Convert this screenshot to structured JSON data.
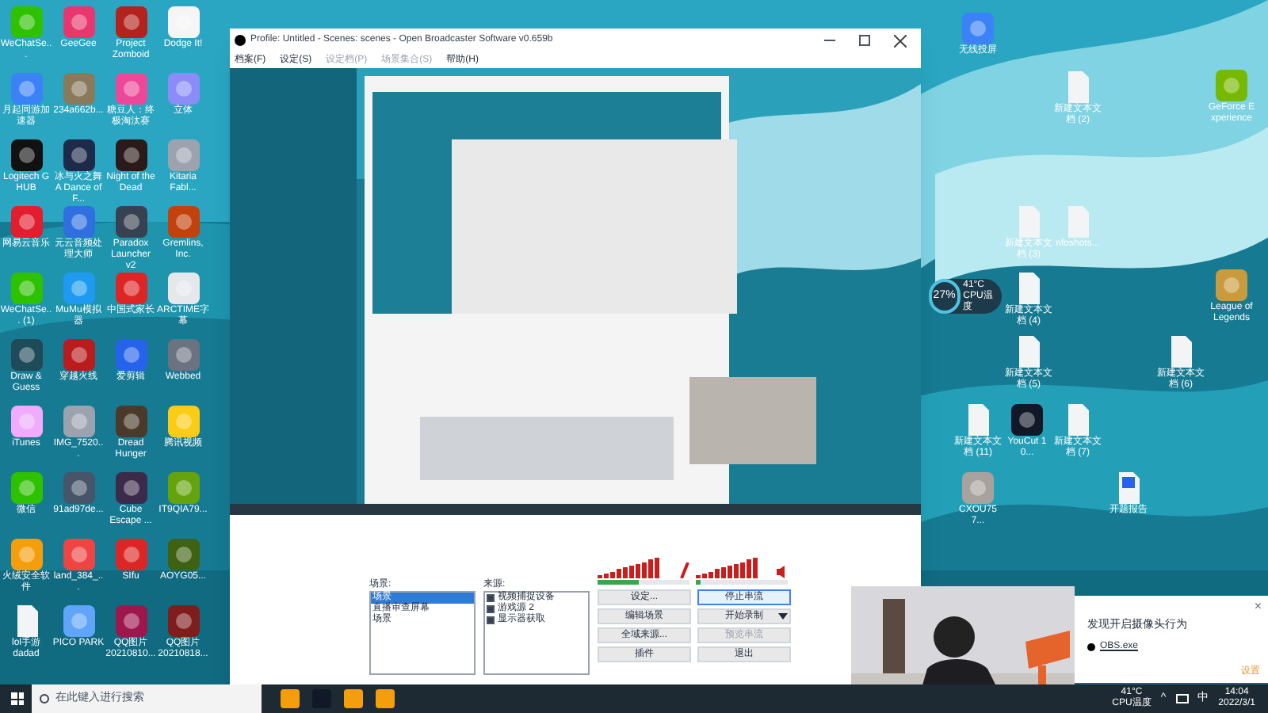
{
  "desktop": {
    "left_icons": [
      {
        "label": "WeChatSe...",
        "kind": "app",
        "color": "#2dc100"
      },
      {
        "label": "GeeGee",
        "kind": "app",
        "color": "#e8366e"
      },
      {
        "label": "Project Zomboid",
        "kind": "app",
        "color": "#b3221c"
      },
      {
        "label": "Dodge It!",
        "kind": "app",
        "color": "#f5f5f5"
      },
      {
        "label": "月起同游加速器",
        "kind": "app",
        "color": "#3b82f6"
      },
      {
        "label": "234a662b...",
        "kind": "app",
        "color": "#8a7a5c"
      },
      {
        "label": "糖豆人：终极淘汰赛",
        "kind": "app",
        "color": "#ec4899"
      },
      {
        "label": "立体",
        "kind": "app",
        "color": "#8b8cf7"
      },
      {
        "label": "Logitech G HUB",
        "kind": "app",
        "color": "#111111"
      },
      {
        "label": "冰与火之舞 A Dance of F...",
        "kind": "app",
        "color": "#1e2a4a"
      },
      {
        "label": "Night of the Dead",
        "kind": "app",
        "color": "#2a1a1a"
      },
      {
        "label": "Kitaria Fabl...",
        "kind": "app",
        "color": "#9ca3af"
      },
      {
        "label": "网易云音乐",
        "kind": "app",
        "color": "#e11d2e"
      },
      {
        "label": "元云音频处理大师",
        "kind": "app",
        "color": "#2f6fe0"
      },
      {
        "label": "Paradox Launcher v2",
        "kind": "app",
        "color": "#374151"
      },
      {
        "label": "Gremlins, Inc.",
        "kind": "app",
        "color": "#c2410c"
      },
      {
        "label": "WeChatSe... (1)",
        "kind": "app",
        "color": "#2dc100"
      },
      {
        "label": "MuMu模拟器",
        "kind": "app",
        "color": "#1e9bf0"
      },
      {
        "label": "中国式家长",
        "kind": "app",
        "color": "#dc2626"
      },
      {
        "label": "ARCTIME字幕",
        "kind": "app",
        "color": "#e5e7eb"
      },
      {
        "label": "Draw & Guess",
        "kind": "app",
        "color": "#1f4a5a"
      },
      {
        "label": "穿越火线",
        "kind": "app",
        "color": "#b91c1c"
      },
      {
        "label": "爱剪辑",
        "kind": "app",
        "color": "#2563eb"
      },
      {
        "label": "Webbed",
        "kind": "app",
        "color": "#6b7280"
      },
      {
        "label": "iTunes",
        "kind": "app",
        "color": "#f0abfc"
      },
      {
        "label": "IMG_7520...",
        "kind": "app",
        "color": "#9ca3af"
      },
      {
        "label": "Dread Hunger",
        "kind": "app",
        "color": "#4b3a2a"
      },
      {
        "label": "腾讯视频",
        "kind": "app",
        "color": "#facc15"
      },
      {
        "label": "微信",
        "kind": "app",
        "color": "#2dc100"
      },
      {
        "label": "91ad97de...",
        "kind": "app",
        "color": "#475569"
      },
      {
        "label": "Cube Escape ...",
        "kind": "app",
        "color": "#3b2a4a"
      },
      {
        "label": "IT9QIA79...",
        "kind": "app",
        "color": "#65a30d"
      },
      {
        "label": "火绒安全软件",
        "kind": "app",
        "color": "#f59e0b"
      },
      {
        "label": "land_384_...",
        "kind": "app",
        "color": "#ef4444"
      },
      {
        "label": "SIfu",
        "kind": "app",
        "color": "#dc2626"
      },
      {
        "label": "AOYG05...",
        "kind": "app",
        "color": "#3f6212"
      },
      {
        "label": "lol手游 dadad",
        "kind": "file",
        "color": "#f3f4f6"
      },
      {
        "label": "PICO PARK",
        "kind": "app",
        "color": "#60a5fa"
      },
      {
        "label": "QQ图片 20210810...",
        "kind": "app",
        "color": "#9d174d"
      },
      {
        "label": "QQ图片 20210818...",
        "kind": "app",
        "color": "#7f1d1d"
      }
    ],
    "right_icons": [
      {
        "label": "无线投屏",
        "kind": "app",
        "color": "#3b82f6"
      },
      {
        "label": "新建文本文档 (2)",
        "kind": "file",
        "color": "#f3f4f6"
      },
      {
        "label": "GeForce Experience",
        "kind": "app",
        "color": "#76b900"
      },
      {
        "label": "新建文本文档 (3)",
        "kind": "file",
        "color": "#f3f4f6"
      },
      {
        "label": "nfoshots...",
        "kind": "file",
        "color": "#f3f4f6"
      },
      {
        "label": "新建文本文档 (4)",
        "kind": "file",
        "color": "#f3f4f6"
      },
      {
        "label": "League of Legends",
        "kind": "app",
        "color": "#c89b3c"
      },
      {
        "label": "新建文本文档 (5)",
        "kind": "file",
        "color": "#f3f4f6"
      },
      {
        "label": "新建文本文档 (6)",
        "kind": "file",
        "color": "#f3f4f6"
      },
      {
        "label": "新建文本文档 (11)",
        "kind": "file",
        "color": "#f3f4f6"
      },
      {
        "label": "YouCut 10...",
        "kind": "app",
        "color": "#111827"
      },
      {
        "label": "新建文本文档 (7)",
        "kind": "file",
        "color": "#f3f4f6"
      },
      {
        "label": "CXOU757...",
        "kind": "app",
        "color": "#a8a29e"
      },
      {
        "label": "开题报告",
        "kind": "doc",
        "color": "#2563eb"
      }
    ]
  },
  "cpu_widget": {
    "percent": "27%",
    "temp": "41°C",
    "label": "CPU温度"
  },
  "obs": {
    "title": "Profile: Untitled - Scenes: scenes - Open Broadcaster Software v0.659b",
    "menu": [
      {
        "label": "档案(F)",
        "disabled": false
      },
      {
        "label": "设定(S)",
        "disabled": false
      },
      {
        "label": "设定档(P)",
        "disabled": true
      },
      {
        "label": "场景集合(S)",
        "disabled": true
      },
      {
        "label": "帮助(H)",
        "disabled": false
      }
    ],
    "scenes_label": "场景:",
    "scenes": [
      {
        "label": "场景",
        "selected": true
      },
      {
        "label": "直播审查屏幕",
        "selected": false
      },
      {
        "label": "场景",
        "selected": false
      }
    ],
    "sources_label": "来源:",
    "sources": [
      {
        "label": "视频捕捉设备",
        "checked": true
      },
      {
        "label": "游戏源 2",
        "checked": true
      },
      {
        "label": "显示器获取",
        "checked": true
      }
    ],
    "meters": [
      {
        "kind": "mic",
        "level": 0.45
      },
      {
        "kind": "speaker",
        "level": 0.05
      }
    ],
    "buttons": [
      {
        "label": "设定...",
        "disabled": false,
        "dropdown": false,
        "selected": false
      },
      {
        "label": "停止串流",
        "disabled": false,
        "dropdown": false,
        "selected": true
      },
      {
        "label": "编辑场景",
        "disabled": false,
        "dropdown": false,
        "selected": false
      },
      {
        "label": "开始录制",
        "disabled": false,
        "dropdown": true,
        "selected": false
      },
      {
        "label": "全域来源...",
        "disabled": false,
        "dropdown": false,
        "selected": false
      },
      {
        "label": "预览串流",
        "disabled": true,
        "dropdown": false,
        "selected": false
      },
      {
        "label": "插件",
        "disabled": false,
        "dropdown": false,
        "selected": false
      },
      {
        "label": "退出",
        "disabled": false,
        "dropdown": false,
        "selected": false
      }
    ]
  },
  "notification": {
    "title": "发现开启摄像头行为",
    "app": "OBS.exe",
    "link": "设置",
    "close": "×"
  },
  "taskbar": {
    "search_placeholder": "在此键入进行搜索",
    "apps": [
      {
        "color": "#f59e0b"
      },
      {
        "color": "#111827"
      },
      {
        "color": "#f59e0b"
      },
      {
        "color": "#f59e0b"
      }
    ],
    "temp": "41°C",
    "temp_label": "CPU温度",
    "caret": "^",
    "ime": "中",
    "time": "14:04",
    "date": "2022/3/1"
  }
}
